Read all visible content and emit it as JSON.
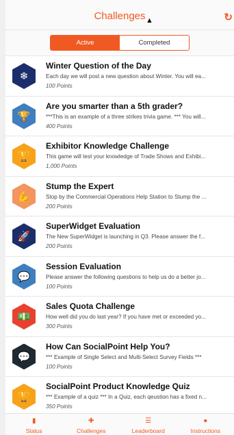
{
  "header": {
    "title": "Challenges",
    "refresh_icon": "refresh-icon"
  },
  "segmented": {
    "active_label": "Active",
    "completed_label": "Completed"
  },
  "challenges": [
    {
      "title": "Winter Question of the Day",
      "desc": "Each day we will post a new question about Winter. You will ea...",
      "points": "100 Points",
      "icon": "snowflake-icon",
      "glyph": "❄",
      "color": "#1c2d6b"
    },
    {
      "title": "Are you smarter than a 5th grader?",
      "desc": "***This is an example of a three strikes trivia game. *** You will...",
      "points": "400 Points",
      "icon": "trophy-icon",
      "glyph": "🏆",
      "color": "#3f7fc0"
    },
    {
      "title": "Exhibitor Knowledge Challenge",
      "desc": "This game will test your knowledge of Trade Shows and Exhibi...",
      "points": "1,000 Points",
      "icon": "trophy-icon",
      "glyph": "🏆",
      "color": "#f7a21b"
    },
    {
      "title": "Stump the Expert",
      "desc": "Stop by the Commercial Operations Help Station to Stump the ...",
      "points": "200 Points",
      "icon": "flexed-arm-icon",
      "glyph": "💪",
      "color": "#f2955f"
    },
    {
      "title": "SuperWidget Evaluation",
      "desc": "The New SuperWidget is launching in Q3. Please answer the f...",
      "points": "200 Points",
      "icon": "rocket-icon",
      "glyph": "🚀",
      "color": "#1c2d6b"
    },
    {
      "title": "Session Evaluation",
      "desc": "Please answer the following questions to help us do a better jo...",
      "points": "100 Points",
      "icon": "chat-bubble-icon",
      "glyph": "💬",
      "color": "#3f7fc0"
    },
    {
      "title": "Sales Quota Challenge",
      "desc": "How well did you do last year? If you have met or exceeded yo...",
      "points": "300 Points",
      "icon": "money-icon",
      "glyph": "💵",
      "color": "#e8412e"
    },
    {
      "title": "How Can SocialPoint Help You?",
      "desc": "*** Example of Single Select and Multi-Select Survey Fields ***",
      "points": "100 Points",
      "icon": "speech-bubble-icon",
      "glyph": "💬",
      "color": "#1f2a33"
    },
    {
      "title": "SocialPoint Product Knowledge Quiz",
      "desc": "*** Example of a quiz *** In a Quiz, each qeustion has a fixed n...",
      "points": "350 Points",
      "icon": "trophy-icon",
      "glyph": "🏆",
      "color": "#f7a21b"
    }
  ],
  "tabs": [
    {
      "label": "Status",
      "icon": "bar-chart-icon",
      "glyph": "▮"
    },
    {
      "label": "Challenges",
      "icon": "puzzle-icon",
      "glyph": "✚"
    },
    {
      "label": "Leaderboard",
      "icon": "list-icon",
      "glyph": "☰"
    },
    {
      "label": "Instructions",
      "icon": "info-icon",
      "glyph": "●"
    }
  ]
}
